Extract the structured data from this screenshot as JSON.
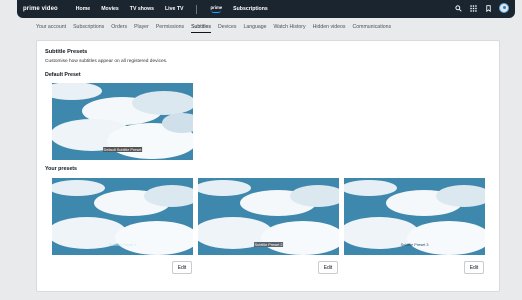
{
  "header": {
    "logo": "prime video",
    "nav": [
      "Home",
      "Movies",
      "TV shows",
      "Live TV"
    ],
    "subscriptions_brand": "prime",
    "subscriptions_label": "Subscriptions"
  },
  "account_tabs": [
    "Your account",
    "Subscriptions",
    "Orders",
    "Player",
    "Permissions",
    "Subtitles",
    "Devices",
    "Language",
    "Watch History",
    "Hidden videos",
    "Communications"
  ],
  "active_tab": "Subtitles",
  "page": {
    "title": "Subtitle Presets",
    "description": "Customise how subtitles appear on all registered devices.",
    "default_heading": "Default Preset",
    "default_caption": "Default Subtitle Preset",
    "your_presets_heading": "Your presets",
    "presets": [
      {
        "caption": "Subtitle Preset 1",
        "edit_label": "Edit"
      },
      {
        "caption": "Subtitle Preset 2",
        "edit_label": "Edit"
      },
      {
        "caption": "Subtitle Preset 3",
        "edit_label": "Edit"
      }
    ]
  },
  "colors": {
    "header_bg": "#1b2530",
    "sky": "#3f88ad",
    "accent": "#1aa3ff"
  }
}
